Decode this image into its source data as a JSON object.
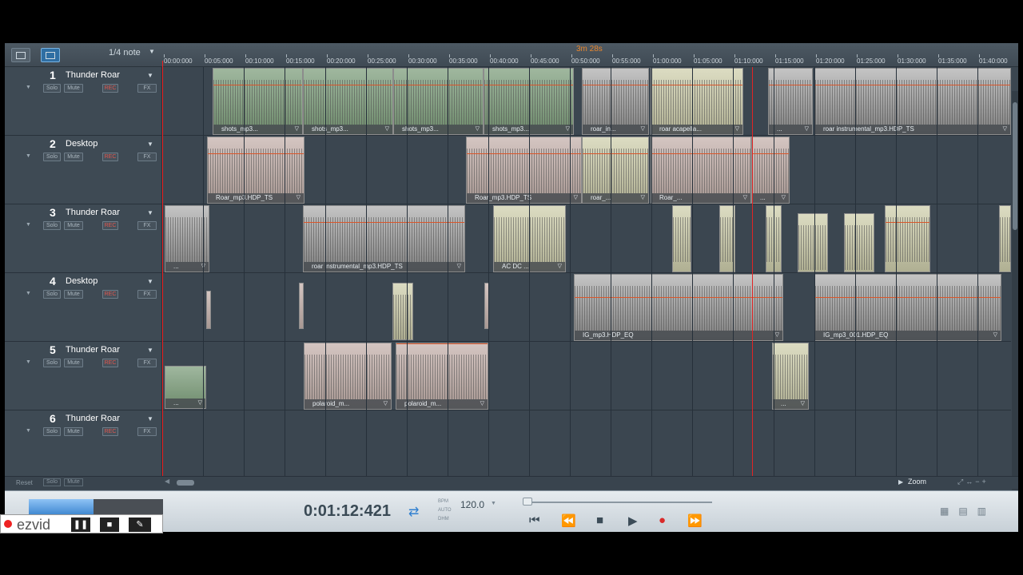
{
  "toolbar": {
    "snap_value": "1/4 note",
    "song_length": "3m 28s"
  },
  "ruler": {
    "ticks": [
      "00:00:000",
      "00:05:000",
      "00:10:000",
      "00:15:000",
      "00:20:000",
      "00:25:000",
      "00:30:000",
      "00:35:000",
      "00:40:000",
      "00:45:000",
      "00:50:000",
      "00:55:000",
      "01:00:000",
      "01:05:000",
      "01:10:000",
      "01:15:000",
      "01:20:000",
      "01:25:000",
      "01:30:000",
      "01:35:000",
      "01:40:000"
    ]
  },
  "tracks": [
    {
      "number": "1",
      "name": "Thunder Roar",
      "solo": "Solo",
      "mute": "Mute",
      "rec": "REC",
      "fx": "FX"
    },
    {
      "number": "2",
      "name": "Desktop",
      "solo": "Solo",
      "mute": "Mute",
      "rec": "REC",
      "fx": "FX"
    },
    {
      "number": "3",
      "name": "Thunder Roar",
      "solo": "Solo",
      "mute": "Mute",
      "rec": "REC",
      "fx": "FX"
    },
    {
      "number": "4",
      "name": "Desktop",
      "solo": "Solo",
      "mute": "Mute",
      "rec": "REC",
      "fx": "FX"
    },
    {
      "number": "5",
      "name": "Thunder Roar",
      "solo": "Solo",
      "mute": "Mute",
      "rec": "REC",
      "fx": "FX"
    },
    {
      "number": "6",
      "name": "Thunder Roar",
      "solo": "Solo",
      "mute": "Mute",
      "rec": "REC",
      "fx": "FX"
    }
  ],
  "clips": {
    "t1": [
      "shots_mp3...",
      "shots_mp3...",
      "shots_mp3...",
      "shots_mp3...",
      "roar_in...",
      "roar acapella...",
      "...",
      "roar instrumental_mp3.HDP_TS"
    ],
    "t2": [
      "Roar_mp3.HDP_TS",
      "Roar_mp3.HDP_TS",
      "roar_...",
      "Roar_...",
      "..."
    ],
    "t3": [
      "...",
      "roar instrumental_mp3.HDP_TS",
      "AC DC ..."
    ],
    "t4": [
      "IG_mp3.HDP_EQ",
      "IG_mp3_001.HDP_EQ"
    ],
    "t5": [
      "...",
      "polaroid_m...",
      "polaroid_m...",
      "..."
    ]
  },
  "footer": {
    "reset": "Reset",
    "solo": "Solo",
    "mute": "Mute",
    "zoom": "Zoom"
  },
  "transport": {
    "time": "0:01:12:421",
    "bpm_labels": [
      "BPM",
      "AUTO",
      "DHM"
    ],
    "bpm": "120.0",
    "meter_fill": 0.48
  },
  "recorder": {
    "logo": "ezvid"
  },
  "colors": {
    "playhead": "#ee2020",
    "volume_curve": "#d9562b",
    "song_length": "#e8862e",
    "accent_blue": "#2f7fd0"
  }
}
